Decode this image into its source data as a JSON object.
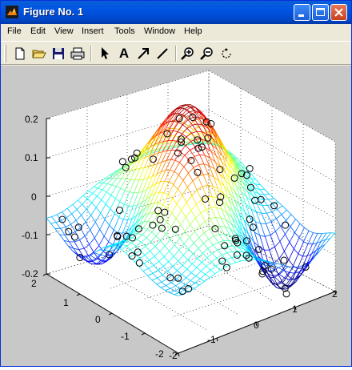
{
  "window": {
    "title": "Figure No. 1"
  },
  "menu": [
    {
      "label": "File"
    },
    {
      "label": "Edit"
    },
    {
      "label": "View"
    },
    {
      "label": "Insert"
    },
    {
      "label": "Tools"
    },
    {
      "label": "Window"
    },
    {
      "label": "Help"
    }
  ],
  "toolbar": {
    "tools": [
      "new-file-icon",
      "open-folder-icon",
      "save-icon",
      "print-icon",
      "pointer-arrow-icon",
      "text-tool-icon",
      "arrow-tool-icon",
      "line-tool-icon",
      "zoom-in-icon",
      "zoom-out-icon",
      "rotate-3d-icon"
    ],
    "text_tool_label": "A"
  },
  "plot": {
    "z_ticks": [
      "0.2",
      "0.1",
      "0",
      "-0.1",
      "-0.2"
    ],
    "y_ticks": [
      "2",
      "1",
      "0",
      "-1",
      "-2"
    ],
    "x_ticks": [
      "-2",
      "-1",
      "0",
      "1",
      "2"
    ],
    "colormap": "jet",
    "grid": true
  }
}
